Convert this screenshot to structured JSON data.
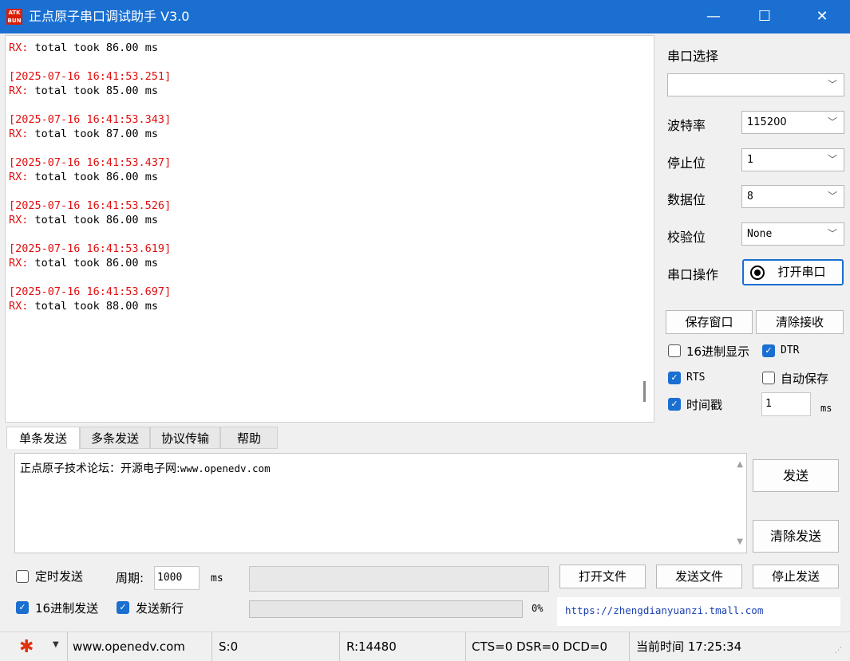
{
  "window": {
    "logo_text": "ATK BUN",
    "title": "正点原子串口调试助手 V3.0",
    "minimize_glyph": "—",
    "maximize_glyph": "☐",
    "close_glyph": "✕"
  },
  "receive": {
    "entries": [
      {
        "timestamp": "",
        "rx_label": "RX:",
        "text": " total took 86.00 ms"
      },
      {
        "timestamp": "[2025-07-16 16:41:53.251]",
        "rx_label": "RX:",
        "text": " total took 85.00 ms"
      },
      {
        "timestamp": "[2025-07-16 16:41:53.343]",
        "rx_label": "RX:",
        "text": " total took 87.00 ms"
      },
      {
        "timestamp": "[2025-07-16 16:41:53.437]",
        "rx_label": "RX:",
        "text": " total took 86.00 ms"
      },
      {
        "timestamp": "[2025-07-16 16:41:53.526]",
        "rx_label": "RX:",
        "text": " total took 86.00 ms"
      },
      {
        "timestamp": "[2025-07-16 16:41:53.619]",
        "rx_label": "RX:",
        "text": " total took 86.00 ms"
      },
      {
        "timestamp": "[2025-07-16 16:41:53.697]",
        "rx_label": "RX:",
        "text": " total took 88.00 ms"
      }
    ]
  },
  "settings": {
    "port_select_label": "串口选择",
    "port_value": "",
    "baud_label": "波特率",
    "baud_value": "115200",
    "stopbits_label": "停止位",
    "stopbits_value": "1",
    "databits_label": "数据位",
    "databits_value": "8",
    "parity_label": "校验位",
    "parity_value": "None",
    "port_op_label": "串口操作",
    "open_port_button": "打开串口",
    "save_window_button": "保存窗口",
    "clear_receive_button": "清除接收",
    "hex_display_label": "16进制显示",
    "hex_display_checked": false,
    "dtr_label": "DTR",
    "dtr_checked": true,
    "rts_label": "RTS",
    "rts_checked": true,
    "auto_save_label": "自动保存",
    "auto_save_checked": false,
    "timestamp_label": "时间戳",
    "timestamp_checked": true,
    "timestamp_value": "1",
    "timestamp_unit": "ms"
  },
  "tabs": [
    "单条发送",
    "多条发送",
    "协议传输",
    "帮助"
  ],
  "send": {
    "text_prefix": "正点原子技术论坛：开源电子网:",
    "text_url": "www.openedv.com",
    "send_button": "发送",
    "clear_send_button": "清除发送",
    "timed_send_label": "定时发送",
    "timed_send_checked": false,
    "period_label": "周期:",
    "period_value": "1000",
    "period_unit": "ms",
    "open_file_button": "打开文件",
    "send_file_button": "发送文件",
    "stop_send_button": "停止发送",
    "hex_send_label": "16进制发送",
    "hex_send_checked": true,
    "send_newline_label": "发送新行",
    "send_newline_checked": true,
    "progress_percent": "0%",
    "progress_value": 0,
    "shop_link": "https://zhengdianyuanzi.tmall.com"
  },
  "statusbar": {
    "website": "www.openedv.com",
    "sent": "S:0",
    "received": "R:14480",
    "line_status": "CTS=0 DSR=0 DCD=0",
    "current_time": "当前时间 17:25:34"
  },
  "colors": {
    "titlebar": "#1a6fd1",
    "timestamp_red": "#e01010",
    "checkbox_blue": "#1a6fd1",
    "link_blue": "#1a3fb0"
  }
}
